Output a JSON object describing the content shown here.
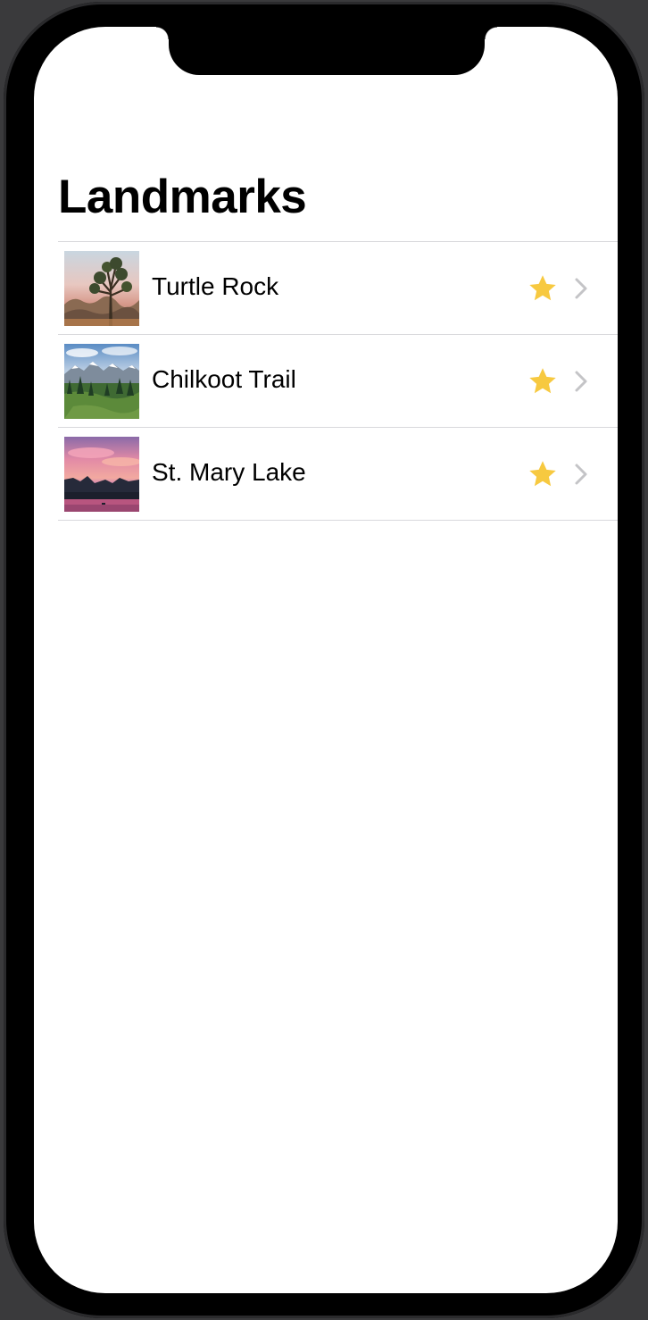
{
  "nav": {
    "title": "Landmarks"
  },
  "landmarks": [
    {
      "name": "Turtle Rock",
      "is_favorite": true,
      "thumbnail": "joshua-tree-desert-photo"
    },
    {
      "name": "Chilkoot Trail",
      "is_favorite": true,
      "thumbnail": "snowy-mountains-forest-photo"
    },
    {
      "name": "St. Mary Lake",
      "is_favorite": true,
      "thumbnail": "pink-sunset-lake-photo"
    }
  ],
  "icons": {
    "favorite": "star-fill-icon",
    "disclosure": "chevron-right-icon"
  },
  "colors": {
    "star": "#F7C940",
    "chevron": "#C4C4C7",
    "separator": "#D8D8DC",
    "background": "#FFFFFF"
  }
}
